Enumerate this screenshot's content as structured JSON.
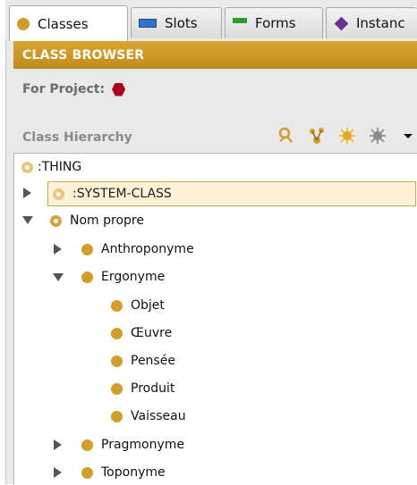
{
  "tabs": [
    {
      "label": "Classes",
      "icon": "class-dot-icon",
      "active": true
    },
    {
      "label": "Slots",
      "icon": "slot-rect-icon",
      "active": false
    },
    {
      "label": "Forms",
      "icon": "forms-icon",
      "active": false
    },
    {
      "label": "Instanc",
      "icon": "instance-diamond-icon",
      "active": false
    }
  ],
  "class_browser": {
    "title": "CLASS BROWSER",
    "for_project_label": "For Project:",
    "project_icon": "project-hexagon-icon",
    "hierarchy_label": "Class Hierarchy",
    "toolbar": [
      "find-class-icon",
      "add-subclass-icon",
      "create-class-icon",
      "delete-class-icon",
      "menu-dropdown-icon"
    ]
  },
  "tree": [
    {
      "label": ":THING",
      "level": 0,
      "toggle": "none",
      "icon": "abstract"
    },
    {
      "label": ":SYSTEM-CLASS",
      "level": 1,
      "toggle": "collapsed",
      "icon": "abstract-light",
      "selected": true
    },
    {
      "label": "Nom propre",
      "level": 1,
      "toggle": "expanded",
      "icon": "abstract"
    },
    {
      "label": "Anthroponyme",
      "level": 2,
      "toggle": "collapsed",
      "icon": "solid"
    },
    {
      "label": "Ergonyme",
      "level": 2,
      "toggle": "expanded",
      "icon": "solid"
    },
    {
      "label": "Objet",
      "level": 3,
      "toggle": "none",
      "icon": "solid"
    },
    {
      "label": "Œuvre",
      "level": 3,
      "toggle": "none",
      "icon": "solid"
    },
    {
      "label": "Pensée",
      "level": 3,
      "toggle": "none",
      "icon": "solid"
    },
    {
      "label": "Produit",
      "level": 3,
      "toggle": "none",
      "icon": "solid"
    },
    {
      "label": "Vaisseau",
      "level": 3,
      "toggle": "none",
      "icon": "solid"
    },
    {
      "label": "Pragmonyme",
      "level": 2,
      "toggle": "collapsed",
      "icon": "solid"
    },
    {
      "label": "Toponyme",
      "level": 2,
      "toggle": "collapsed",
      "icon": "solid"
    }
  ],
  "colors": {
    "accent": "#c8911f",
    "selection_bg": "#fdf1d8",
    "class_icon": "#d39d2a"
  }
}
